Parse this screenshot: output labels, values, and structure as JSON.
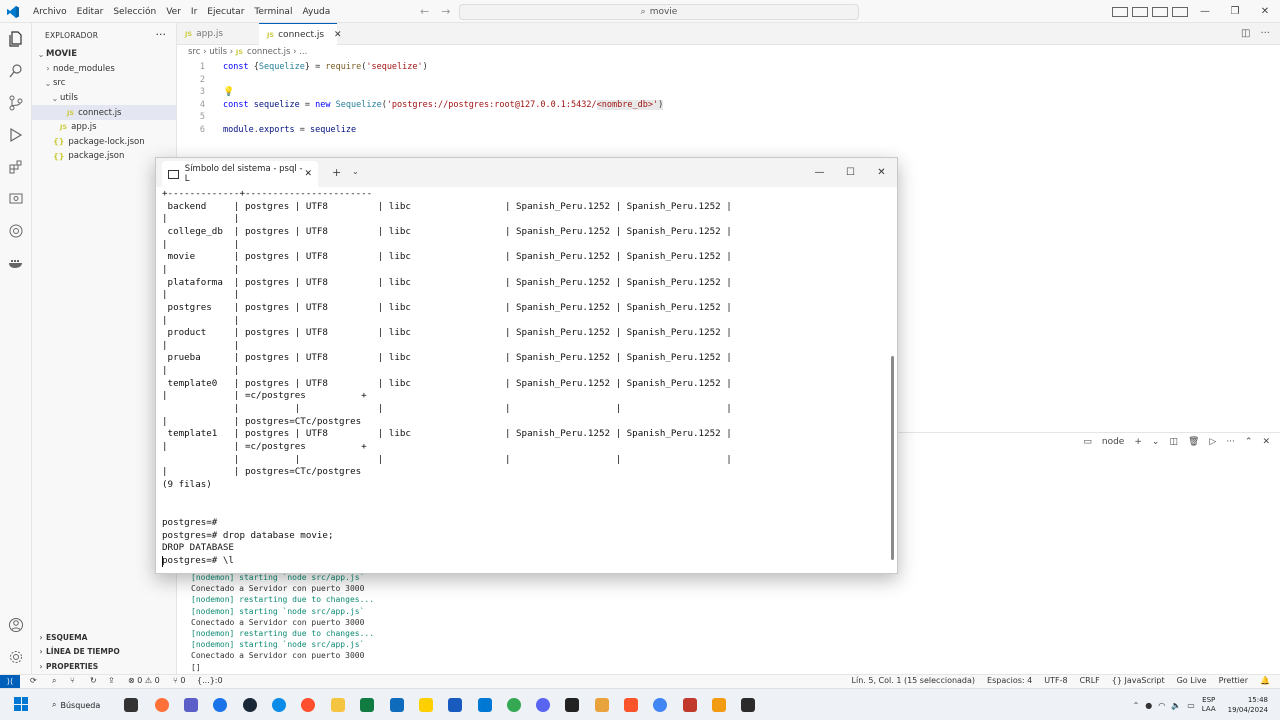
{
  "titlebar": {
    "menus": [
      "Archivo",
      "Editar",
      "Selección",
      "Ver",
      "Ir",
      "Ejecutar",
      "Terminal",
      "Ayuda"
    ],
    "search": "movie"
  },
  "sidebar": {
    "header": "EXPLORADOR",
    "items": [
      {
        "label": "MOVIE",
        "depth": 0,
        "chevron": "down",
        "bold": true
      },
      {
        "label": "node_modules",
        "depth": 1,
        "chevron": "right"
      },
      {
        "label": "src",
        "depth": 1,
        "chevron": "down"
      },
      {
        "label": "utils",
        "depth": 2,
        "chevron": "down"
      },
      {
        "label": "connect.js",
        "depth": 3,
        "badge": "JS",
        "selected": true
      },
      {
        "label": "app.js",
        "depth": 2,
        "badge": "JS"
      },
      {
        "label": "package-lock.json",
        "depth": 1,
        "badge": "{}"
      },
      {
        "label": "package.json",
        "depth": 1,
        "badge": "{}"
      }
    ],
    "sections": [
      "ESQUEMA",
      "LÍNEA DE TIEMPO",
      "PROPERTIES"
    ]
  },
  "editor": {
    "tabs": [
      {
        "label": "app.js",
        "badge": "JS",
        "active": false
      },
      {
        "label": "connect.js",
        "badge": "JS",
        "active": true
      }
    ],
    "breadcrumb": [
      "src",
      "utils",
      "connect.js",
      "..."
    ],
    "line_numbers": [
      "1",
      "2",
      "3",
      "4",
      "5",
      "6"
    ],
    "code": {
      "l1": {
        "kw": "const",
        "p1": "{",
        "var": "Sequelize",
        "p2": "} = ",
        "fn": "require",
        "p3": "(",
        "str": "'sequelize'",
        "p4": ")"
      },
      "l4": {
        "kw": "const",
        "var": "sequelize",
        "p1": " = ",
        "kw2": "new",
        "cls": "Sequelize",
        "p2": "(",
        "str": "'postgres://postgres:root@127.0.0.1:5432/",
        "hl": "<nombre_db>'",
        "p3": ")"
      },
      "l6": {
        "var": "module",
        "p1": ".",
        "var2": "exports",
        "p2": " = ",
        "var3": "sequelize"
      }
    }
  },
  "panel": {
    "terminal_name": "node",
    "log": [
      {
        "text": "[nodemon] starting `node src/app.js`",
        "kind": "g"
      },
      {
        "text": "Conectado a Servidor con puerto 3000",
        "kind": "w"
      },
      {
        "text": "[nodemon] restarting due to changes...",
        "kind": "g"
      },
      {
        "text": "[nodemon] starting `node src/app.js`",
        "kind": "g"
      },
      {
        "text": "Conectado a Servidor con puerto 3000",
        "kind": "w"
      },
      {
        "text": "[nodemon] restarting due to changes...",
        "kind": "g"
      },
      {
        "text": "[nodemon] starting `node src/app.js`",
        "kind": "g"
      },
      {
        "text": "Conectado a Servidor con puerto 3000",
        "kind": "w"
      },
      {
        "text": "[]",
        "kind": "w"
      }
    ]
  },
  "psql": {
    "tab_title": "Símbolo del sistema - psql  -L",
    "lines": [
      "+-------------+-----------------------",
      " backend     | postgres | UTF8         | libc                 | Spanish_Peru.1252 | Spanish_Peru.1252 |",
      "|            |",
      " college_db  | postgres | UTF8         | libc                 | Spanish_Peru.1252 | Spanish_Peru.1252 |",
      "|            |",
      " movie       | postgres | UTF8         | libc                 | Spanish_Peru.1252 | Spanish_Peru.1252 |",
      "|            |",
      " plataforma  | postgres | UTF8         | libc                 | Spanish_Peru.1252 | Spanish_Peru.1252 |",
      "|            |",
      " postgres    | postgres | UTF8         | libc                 | Spanish_Peru.1252 | Spanish_Peru.1252 |",
      "|            |",
      " product     | postgres | UTF8         | libc                 | Spanish_Peru.1252 | Spanish_Peru.1252 |",
      "|            |",
      " prueba      | postgres | UTF8         | libc                 | Spanish_Peru.1252 | Spanish_Peru.1252 |",
      "|            |",
      " template0   | postgres | UTF8         | libc                 | Spanish_Peru.1252 | Spanish_Peru.1252 |",
      "|            | =c/postgres          +",
      "             |          |              |                      |                   |                   |",
      "|            | postgres=CTc/postgres",
      " template1   | postgres | UTF8         | libc                 | Spanish_Peru.1252 | Spanish_Peru.1252 |",
      "|            | =c/postgres          +",
      "             |          |              |                      |                   |                   |",
      "|            | postgres=CTc/postgres",
      "(9 filas)",
      "",
      "",
      "postgres=#",
      "postgres=# drop database movie;",
      "DROP DATABASE",
      "postgres=# \\l"
    ]
  },
  "statusbar": {
    "left": [
      "⊗ 0  ⚠ 0",
      "⑂ 0",
      "{...}:0"
    ],
    "right": [
      "Lín. 5, Col. 1 (15 seleccionada)",
      "Espacios: 4",
      "UTF-8",
      "CRLF",
      "{} JavaScript",
      "Go Live",
      "Prettier"
    ]
  },
  "taskbar": {
    "search": "Búsqueda",
    "lang": [
      "ESP",
      "LAA"
    ],
    "time": "15:48",
    "date": "19/04/2024"
  }
}
